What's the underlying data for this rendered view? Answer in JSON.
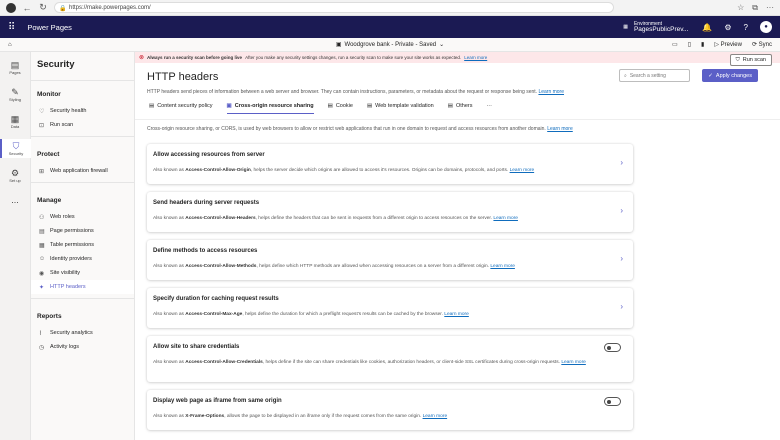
{
  "browser": {
    "url": "https://make.powerpages.com/"
  },
  "app": {
    "title": "Power Pages",
    "env_label": "Environment",
    "env_name": "PagesPublicPrev..."
  },
  "toolbar": {
    "site": "Woodgrove bank - Private - Saved",
    "preview": "Preview",
    "sync": "Sync"
  },
  "rail": [
    {
      "label": "Pages",
      "icon": "page-icon"
    },
    {
      "label": "Styling",
      "icon": "brush-icon"
    },
    {
      "label": "Data",
      "icon": "table-icon"
    },
    {
      "label": "Security",
      "icon": "shield-icon"
    },
    {
      "label": "Set up",
      "icon": "gear-icon"
    },
    {
      "label": "...",
      "icon": "more-icon"
    }
  ],
  "sidebar": {
    "title": "Security",
    "monitor": {
      "title": "Monitor",
      "items": [
        "Security health",
        "Run scan"
      ]
    },
    "protect": {
      "title": "Protect",
      "items": [
        "Web application firewall"
      ]
    },
    "manage": {
      "title": "Manage",
      "items": [
        "Web roles",
        "Page permissions",
        "Table permissions",
        "Identity providers",
        "Site visibility",
        "HTTP headers"
      ]
    },
    "reports": {
      "title": "Reports",
      "items": [
        "Security analytics",
        "Activity logs"
      ]
    }
  },
  "warning": {
    "bold": "Always run a security scan before going live",
    "text": "After you make any security settings changes, run a security scan to make sure your site works as expected.",
    "link": "Learn more",
    "button": "Run scan"
  },
  "page": {
    "title": "HTTP headers",
    "search_placeholder": "Search a setting",
    "apply": "Apply changes",
    "description": "HTTP headers send pieces of information between a web server and browser. They can contain instructions, parameters, or metadata about the request or response being sent.",
    "learn_more": "Learn more",
    "tabs": [
      "Content security policy",
      "Cross-origin resource sharing",
      "Cookie",
      "Web template validation",
      "Others",
      "···"
    ],
    "intro": "Cross-origin resource sharing, or CORS, is used by web browsers to allow or restrict web applications that run in one domain to request and access resources from another domain.",
    "cards": [
      {
        "title": "Allow accessing resources from server",
        "pre": "Also known as ",
        "name": "Access-Control-Allow-Origin",
        "post": ", helps the server decide which origins are allowed to access it's resources. Origins can be domains, protocols, and ports.",
        "link": "Learn more"
      },
      {
        "title": "Send headers during server requests",
        "pre": "Also known as ",
        "name": "Access-Control-Allow-Headers",
        "post": ", helps define the headers that can be sent in requests from a different origin to access resources on the server.",
        "link": "Learn more"
      },
      {
        "title": "Define methods to access resources",
        "pre": "Also known as ",
        "name": "Access-Control-Allow-Methods",
        "post": ", helps define which HTTP methods are allowed when accessing resources on a server from a different origin.",
        "link": "Learn more"
      },
      {
        "title": "Specify duration for caching request results",
        "pre": "Also known as ",
        "name": "Access-Control-Max-Age",
        "post": ", helps define the duration for which a preflight request's results can be cached by the browser.",
        "link": "Learn more"
      },
      {
        "title": "Allow site to share credentials",
        "pre": "Also known as ",
        "name": "Access-Control-Allow-Credentials",
        "post": ", helps define if the site can share credentials like cookies, authorization headers, or client-side SSL certificates during cross-origin requests.",
        "link": "Learn more"
      },
      {
        "title": "Display web page as iframe from same origin",
        "pre": "Also known as ",
        "name": "X-Frame-Options",
        "post": ", allows the page to be displayed in an iframe only if the request comes from the same origin.",
        "link": "Learn more"
      }
    ]
  },
  "colors": {
    "accent": "#5b5fc7",
    "appbar": "#1b1a53",
    "warning_bg": "#fde7e9"
  }
}
